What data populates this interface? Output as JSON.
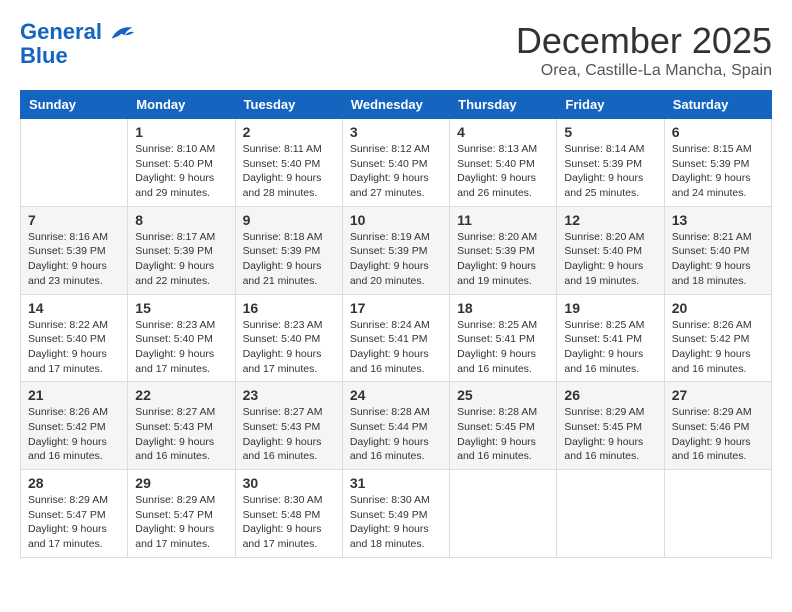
{
  "header": {
    "logo_line1": "General",
    "logo_line2": "Blue",
    "month": "December 2025",
    "location": "Orea, Castille-La Mancha, Spain"
  },
  "days_of_week": [
    "Sunday",
    "Monday",
    "Tuesday",
    "Wednesday",
    "Thursday",
    "Friday",
    "Saturday"
  ],
  "weeks": [
    [
      {
        "day": "",
        "info": ""
      },
      {
        "day": "1",
        "info": "Sunrise: 8:10 AM\nSunset: 5:40 PM\nDaylight: 9 hours\nand 29 minutes."
      },
      {
        "day": "2",
        "info": "Sunrise: 8:11 AM\nSunset: 5:40 PM\nDaylight: 9 hours\nand 28 minutes."
      },
      {
        "day": "3",
        "info": "Sunrise: 8:12 AM\nSunset: 5:40 PM\nDaylight: 9 hours\nand 27 minutes."
      },
      {
        "day": "4",
        "info": "Sunrise: 8:13 AM\nSunset: 5:40 PM\nDaylight: 9 hours\nand 26 minutes."
      },
      {
        "day": "5",
        "info": "Sunrise: 8:14 AM\nSunset: 5:39 PM\nDaylight: 9 hours\nand 25 minutes."
      },
      {
        "day": "6",
        "info": "Sunrise: 8:15 AM\nSunset: 5:39 PM\nDaylight: 9 hours\nand 24 minutes."
      }
    ],
    [
      {
        "day": "7",
        "info": "Sunrise: 8:16 AM\nSunset: 5:39 PM\nDaylight: 9 hours\nand 23 minutes."
      },
      {
        "day": "8",
        "info": "Sunrise: 8:17 AM\nSunset: 5:39 PM\nDaylight: 9 hours\nand 22 minutes."
      },
      {
        "day": "9",
        "info": "Sunrise: 8:18 AM\nSunset: 5:39 PM\nDaylight: 9 hours\nand 21 minutes."
      },
      {
        "day": "10",
        "info": "Sunrise: 8:19 AM\nSunset: 5:39 PM\nDaylight: 9 hours\nand 20 minutes."
      },
      {
        "day": "11",
        "info": "Sunrise: 8:20 AM\nSunset: 5:39 PM\nDaylight: 9 hours\nand 19 minutes."
      },
      {
        "day": "12",
        "info": "Sunrise: 8:20 AM\nSunset: 5:40 PM\nDaylight: 9 hours\nand 19 minutes."
      },
      {
        "day": "13",
        "info": "Sunrise: 8:21 AM\nSunset: 5:40 PM\nDaylight: 9 hours\nand 18 minutes."
      }
    ],
    [
      {
        "day": "14",
        "info": "Sunrise: 8:22 AM\nSunset: 5:40 PM\nDaylight: 9 hours\nand 17 minutes."
      },
      {
        "day": "15",
        "info": "Sunrise: 8:23 AM\nSunset: 5:40 PM\nDaylight: 9 hours\nand 17 minutes."
      },
      {
        "day": "16",
        "info": "Sunrise: 8:23 AM\nSunset: 5:40 PM\nDaylight: 9 hours\nand 17 minutes."
      },
      {
        "day": "17",
        "info": "Sunrise: 8:24 AM\nSunset: 5:41 PM\nDaylight: 9 hours\nand 16 minutes."
      },
      {
        "day": "18",
        "info": "Sunrise: 8:25 AM\nSunset: 5:41 PM\nDaylight: 9 hours\nand 16 minutes."
      },
      {
        "day": "19",
        "info": "Sunrise: 8:25 AM\nSunset: 5:41 PM\nDaylight: 9 hours\nand 16 minutes."
      },
      {
        "day": "20",
        "info": "Sunrise: 8:26 AM\nSunset: 5:42 PM\nDaylight: 9 hours\nand 16 minutes."
      }
    ],
    [
      {
        "day": "21",
        "info": "Sunrise: 8:26 AM\nSunset: 5:42 PM\nDaylight: 9 hours\nand 16 minutes."
      },
      {
        "day": "22",
        "info": "Sunrise: 8:27 AM\nSunset: 5:43 PM\nDaylight: 9 hours\nand 16 minutes."
      },
      {
        "day": "23",
        "info": "Sunrise: 8:27 AM\nSunset: 5:43 PM\nDaylight: 9 hours\nand 16 minutes."
      },
      {
        "day": "24",
        "info": "Sunrise: 8:28 AM\nSunset: 5:44 PM\nDaylight: 9 hours\nand 16 minutes."
      },
      {
        "day": "25",
        "info": "Sunrise: 8:28 AM\nSunset: 5:45 PM\nDaylight: 9 hours\nand 16 minutes."
      },
      {
        "day": "26",
        "info": "Sunrise: 8:29 AM\nSunset: 5:45 PM\nDaylight: 9 hours\nand 16 minutes."
      },
      {
        "day": "27",
        "info": "Sunrise: 8:29 AM\nSunset: 5:46 PM\nDaylight: 9 hours\nand 16 minutes."
      }
    ],
    [
      {
        "day": "28",
        "info": "Sunrise: 8:29 AM\nSunset: 5:47 PM\nDaylight: 9 hours\nand 17 minutes."
      },
      {
        "day": "29",
        "info": "Sunrise: 8:29 AM\nSunset: 5:47 PM\nDaylight: 9 hours\nand 17 minutes."
      },
      {
        "day": "30",
        "info": "Sunrise: 8:30 AM\nSunset: 5:48 PM\nDaylight: 9 hours\nand 17 minutes."
      },
      {
        "day": "31",
        "info": "Sunrise: 8:30 AM\nSunset: 5:49 PM\nDaylight: 9 hours\nand 18 minutes."
      },
      {
        "day": "",
        "info": ""
      },
      {
        "day": "",
        "info": ""
      },
      {
        "day": "",
        "info": ""
      }
    ]
  ]
}
